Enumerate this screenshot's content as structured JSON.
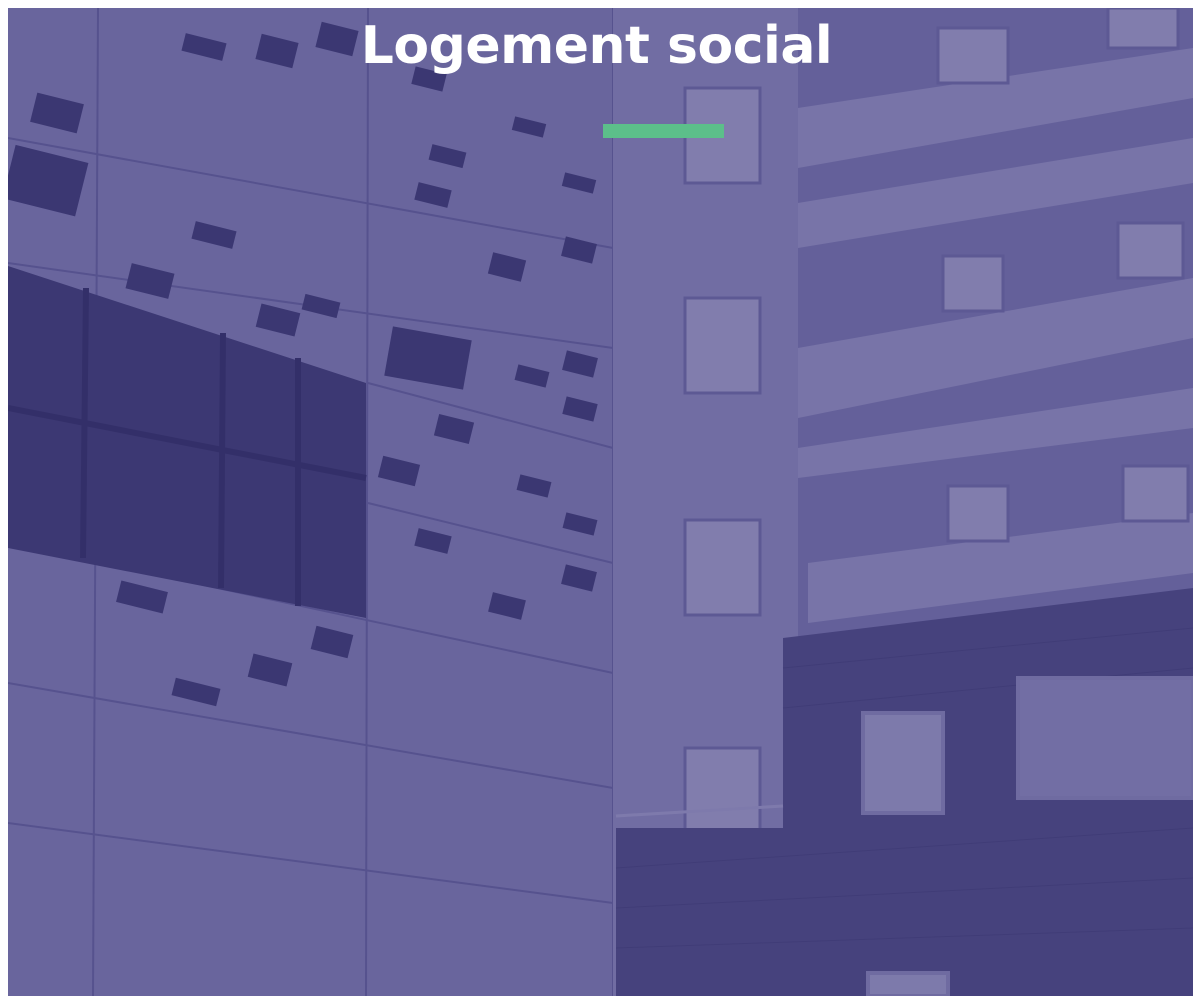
{
  "hero": {
    "title": "Logement social",
    "accent_color": "#5cbf8a",
    "overlay_color": "#3a3672",
    "image_subject": "residential-buildings-photo"
  }
}
